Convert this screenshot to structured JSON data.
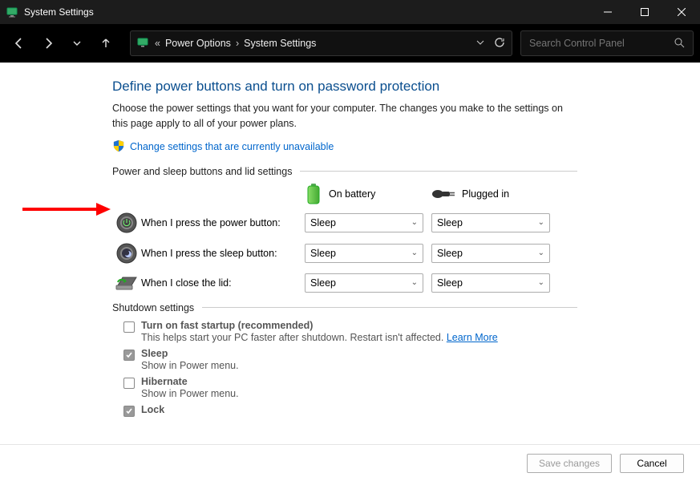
{
  "window": {
    "title": "System Settings"
  },
  "breadcrumb": {
    "item1": "Power Options",
    "item2": "System Settings"
  },
  "search": {
    "placeholder": "Search Control Panel"
  },
  "page": {
    "title": "Define power buttons and turn on password protection",
    "description": "Choose the power settings that you want for your computer. The changes you make to the settings on this page apply to all of your power plans.",
    "uac_link": "Change settings that are currently unavailable"
  },
  "power_section": {
    "label": "Power and sleep buttons and lid settings",
    "col_battery": "On battery",
    "col_plugged": "Plugged in",
    "rows": {
      "power_button": {
        "label": "When I press the power button:",
        "battery": "Sleep",
        "plugged": "Sleep"
      },
      "sleep_button": {
        "label": "When I press the sleep button:",
        "battery": "Sleep",
        "plugged": "Sleep"
      },
      "lid": {
        "label": "When I close the lid:",
        "battery": "Sleep",
        "plugged": "Sleep"
      }
    }
  },
  "shutdown_section": {
    "label": "Shutdown settings",
    "fast_startup": {
      "title": "Turn on fast startup (recommended)",
      "sub": "This helps start your PC faster after shutdown. Restart isn't affected. ",
      "link": "Learn More"
    },
    "sleep": {
      "title": "Sleep",
      "sub": "Show in Power menu."
    },
    "hibernate": {
      "title": "Hibernate",
      "sub": "Show in Power menu."
    },
    "lock": {
      "title": "Lock"
    }
  },
  "footer": {
    "save": "Save changes",
    "cancel": "Cancel"
  }
}
